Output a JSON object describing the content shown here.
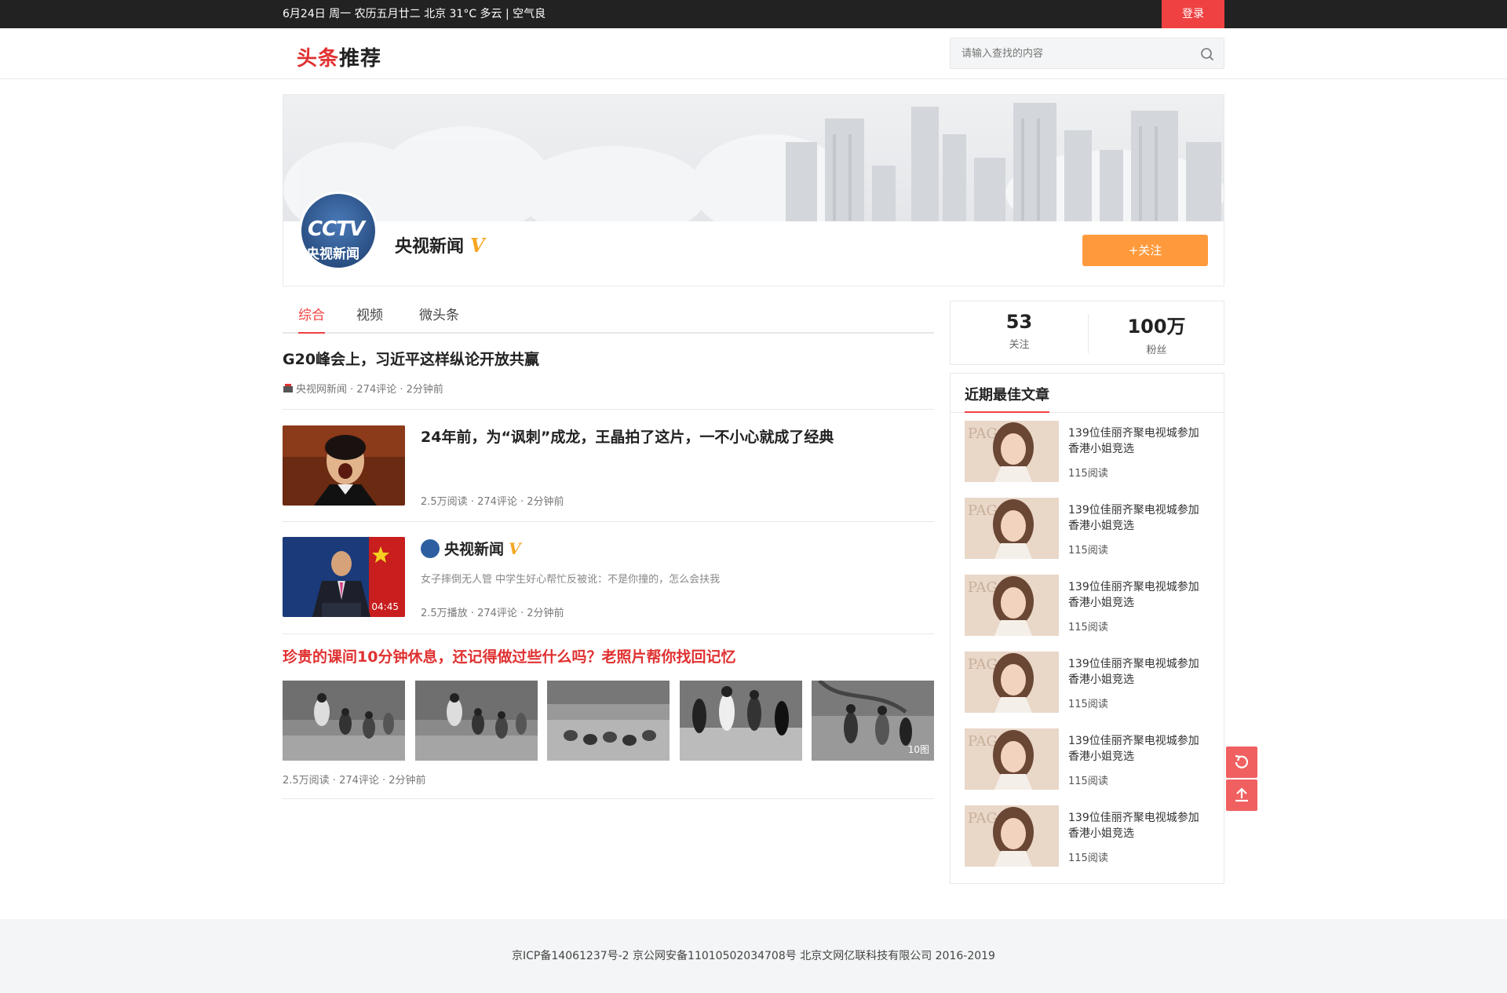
{
  "topbar": {
    "info": "6月24日 周一 农历五月廿二 北京 31°C 多云 | 空气良",
    "login_label": "登录"
  },
  "header": {
    "logo_part1": "头条",
    "logo_part2": "推荐",
    "search_placeholder": "请输入查找的内容",
    "search_icon": "search-icon"
  },
  "profile": {
    "avatar_logo": "CCTV",
    "avatar_cn": "央视新闻",
    "name": "央视新闻",
    "verified": "V",
    "follow_label": "+关注"
  },
  "tabs": [
    "综合",
    "视频",
    "微头条"
  ],
  "articles": [
    {
      "title": "G20峰会上，习近平这样纵论开放共赢",
      "source": "央视网新闻",
      "meta": "央视网新闻 · 274评论 · 2分钟前"
    },
    {
      "title": "24年前，为“讽刺”成龙，王晶拍了这片，一不小心就成了经典",
      "meta": "2.5万阅读 · 274评论 · 2分钟前"
    },
    {
      "author": "央视新闻",
      "verified": "V",
      "desc": "女子摔倒无人管 中学生好心帮忙反被讹：不是你撞的，怎么会扶我",
      "duration": "04:45",
      "meta": "2.5万播放 · 274评论 · 2分钟前"
    },
    {
      "title": "珍贵的课间10分钟休息，还记得做过些什么吗？老照片帮你找回记忆",
      "image_count": "10图",
      "meta": "2.5万阅读 · 274评论 · 2分钟前"
    }
  ],
  "stats": {
    "following": "53",
    "following_label": "关注",
    "fans": "100万",
    "fans_label": "粉丝"
  },
  "best": {
    "heading": "近期最佳文章",
    "items": [
      {
        "title": "139位佳丽齐聚电视城参加香港小姐竞选",
        "reads": "115阅读"
      },
      {
        "title": "139位佳丽齐聚电视城参加香港小姐竞选",
        "reads": "115阅读"
      },
      {
        "title": "139位佳丽齐聚电视城参加香港小姐竞选",
        "reads": "115阅读"
      },
      {
        "title": "139位佳丽齐聚电视城参加香港小姐竞选",
        "reads": "115阅读"
      },
      {
        "title": "139位佳丽齐聚电视城参加香港小姐竞选",
        "reads": "115阅读"
      },
      {
        "title": "139位佳丽齐聚电视城参加香港小姐竞选",
        "reads": "115阅读"
      }
    ]
  },
  "float_buttons": [
    "refresh-icon",
    "back-to-top-icon"
  ],
  "footer": {
    "text": "京ICP备14061237号-2   京公网安备11010502034708号   北京文网亿联科技有限公司 2016-2019"
  },
  "colors": {
    "accent": "#f04142",
    "follow": "#ff9a3c",
    "verified": "#f5a623"
  }
}
